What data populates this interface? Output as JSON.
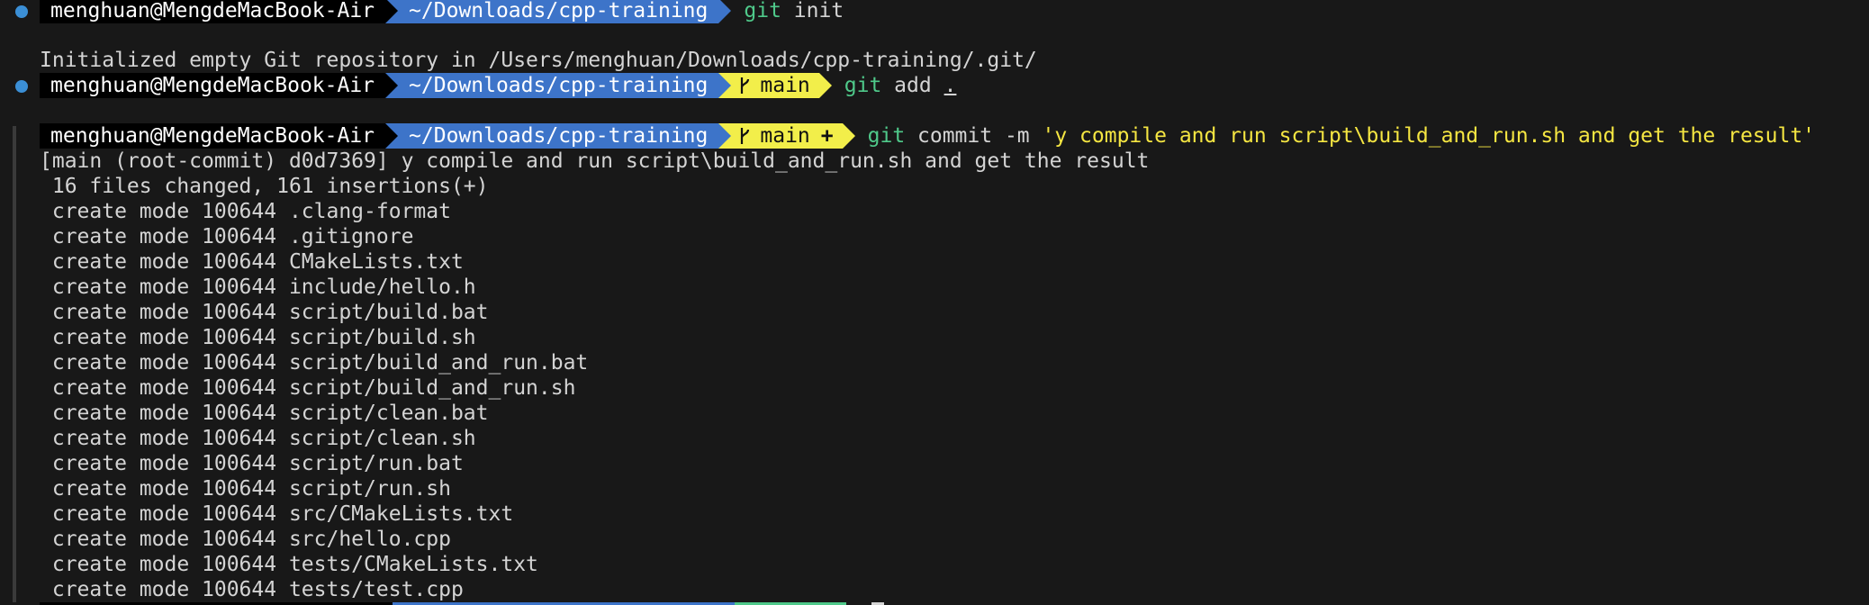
{
  "prompt": {
    "user": "menghuan@MengdeMacBook-Air",
    "path": "~/Downloads/cpp-training",
    "branch": "main",
    "dirty_marker": "+"
  },
  "commands": [
    {
      "git": "git",
      "args": " init",
      "output": "Initialized empty Git repository in /Users/menghuan/Downloads/cpp-training/.git/"
    },
    {
      "git": "git",
      "args": " add ",
      "dot": "."
    },
    {
      "git": "git",
      "args": " commit -m ",
      "message": "'y compile and run script\\build_and_run.sh and get the result'"
    }
  ],
  "commit_output": [
    "[main (root-commit) d0d7369] y compile and run script\\build_and_run.sh and get the result",
    " 16 files changed, 161 insertions(+)",
    " create mode 100644 .clang-format",
    " create mode 100644 .gitignore",
    " create mode 100644 CMakeLists.txt",
    " create mode 100644 include/hello.h",
    " create mode 100644 script/build.bat",
    " create mode 100644 script/build.sh",
    " create mode 100644 script/build_and_run.bat",
    " create mode 100644 script/build_and_run.sh",
    " create mode 100644 script/clean.bat",
    " create mode 100644 script/clean.sh",
    " create mode 100644 script/run.bat",
    " create mode 100644 script/run.sh",
    " create mode 100644 src/CMakeLists.txt",
    " create mode 100644 src/hello.cpp",
    " create mode 100644 tests/CMakeLists.txt",
    " create mode 100644 tests/test.cpp"
  ],
  "colors": {
    "background": "#181818",
    "user_segment": "#000000",
    "path_segment": "#3d74c9",
    "git_segment": "#f2ee4a",
    "command_green": "#4fc98a",
    "string_yellow": "#f5e642",
    "decoration_dot": "#3b8fd6"
  }
}
